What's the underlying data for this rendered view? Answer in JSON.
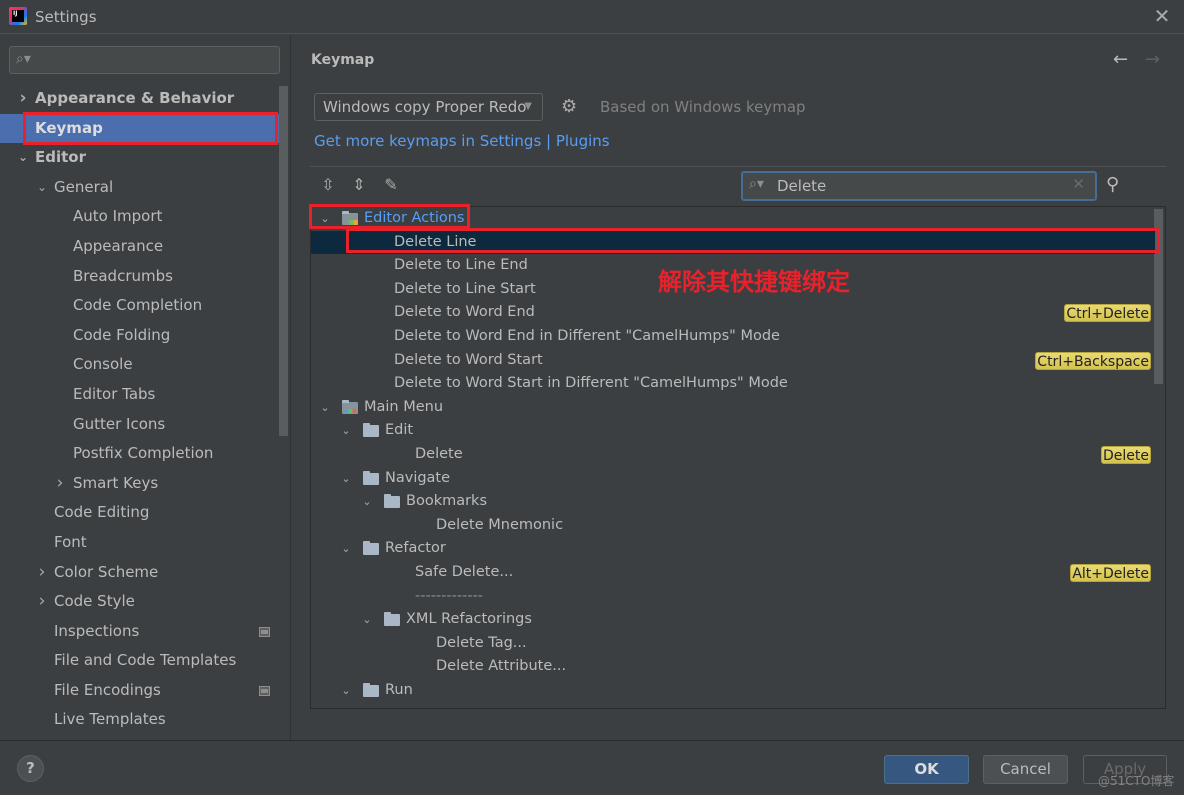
{
  "window": {
    "title": "Settings",
    "close_icon": "close-icon"
  },
  "sidebar": {
    "search": {
      "value": "",
      "placeholder": ""
    },
    "items": [
      {
        "label": "Appearance & Behavior",
        "indent": 0,
        "chevron": "right",
        "bold": true
      },
      {
        "label": "Keymap",
        "indent": 0,
        "chevron": "",
        "bold": true,
        "selected": true
      },
      {
        "label": "Editor",
        "indent": 0,
        "chevron": "down",
        "bold": true
      },
      {
        "label": "General",
        "indent": 1,
        "chevron": "down"
      },
      {
        "label": "Auto Import",
        "indent": 2,
        "chevron": ""
      },
      {
        "label": "Appearance",
        "indent": 2,
        "chevron": ""
      },
      {
        "label": "Breadcrumbs",
        "indent": 2,
        "chevron": ""
      },
      {
        "label": "Code Completion",
        "indent": 2,
        "chevron": ""
      },
      {
        "label": "Code Folding",
        "indent": 2,
        "chevron": ""
      },
      {
        "label": "Console",
        "indent": 2,
        "chevron": ""
      },
      {
        "label": "Editor Tabs",
        "indent": 2,
        "chevron": ""
      },
      {
        "label": "Gutter Icons",
        "indent": 2,
        "chevron": ""
      },
      {
        "label": "Postfix Completion",
        "indent": 2,
        "chevron": ""
      },
      {
        "label": "Smart Keys",
        "indent": 2,
        "chevron": "right"
      },
      {
        "label": "Code Editing",
        "indent": 1,
        "chevron": ""
      },
      {
        "label": "Font",
        "indent": 1,
        "chevron": ""
      },
      {
        "label": "Color Scheme",
        "indent": 1,
        "chevron": "right"
      },
      {
        "label": "Code Style",
        "indent": 1,
        "chevron": "right"
      },
      {
        "label": "Inspections",
        "indent": 1,
        "chevron": "",
        "badge": true
      },
      {
        "label": "File and Code Templates",
        "indent": 1,
        "chevron": ""
      },
      {
        "label": "File Encodings",
        "indent": 1,
        "chevron": "",
        "badge": true
      },
      {
        "label": "Live Templates",
        "indent": 1,
        "chevron": ""
      }
    ]
  },
  "main": {
    "title": "Keymap",
    "keymap_select": "Windows copy Proper Redo",
    "based_on": "Based on Windows keymap",
    "plugins_link": "Get more keymaps in Settings | Plugins",
    "search": {
      "value": "Delete",
      "placeholder": ""
    },
    "annotation": "解除其快捷键绑定",
    "tree": [
      {
        "label": "Editor Actions",
        "level": 0,
        "chevron": "down",
        "icon": "editor",
        "group": true
      },
      {
        "label": "Delete Line",
        "level": 2,
        "selected": true
      },
      {
        "label": "Delete to Line End",
        "level": 2
      },
      {
        "label": "Delete to Line Start",
        "level": 2
      },
      {
        "label": "Delete to Word End",
        "level": 2,
        "shortcut": "Ctrl+Delete"
      },
      {
        "label": "Delete to Word End in Different \"CamelHumps\" Mode",
        "level": 2
      },
      {
        "label": "Delete to Word Start",
        "level": 2,
        "shortcut": "Ctrl+Backspace"
      },
      {
        "label": "Delete to Word Start in Different \"CamelHumps\" Mode",
        "level": 2
      },
      {
        "label": "Main Menu",
        "level": 0,
        "chevron": "down",
        "icon": "menu"
      },
      {
        "label": "Edit",
        "level": 1,
        "chevron": "down",
        "icon": "folder"
      },
      {
        "label": "Delete",
        "level": 3,
        "shortcut": "Delete"
      },
      {
        "label": "Navigate",
        "level": 1,
        "chevron": "down",
        "icon": "folder"
      },
      {
        "label": "Bookmarks",
        "level": 2,
        "chevron": "down",
        "icon": "folder"
      },
      {
        "label": "Delete Mnemonic",
        "level": 4
      },
      {
        "label": "Refactor",
        "level": 1,
        "chevron": "down",
        "icon": "folder"
      },
      {
        "label": "Safe Delete...",
        "level": 3,
        "shortcut": "Alt+Delete"
      },
      {
        "label": "-------------",
        "level": 3,
        "separator": true
      },
      {
        "label": "XML Refactorings",
        "level": 2,
        "chevron": "down",
        "icon": "folder"
      },
      {
        "label": "Delete Tag...",
        "level": 4
      },
      {
        "label": "Delete Attribute...",
        "level": 4
      },
      {
        "label": "Run",
        "level": 1,
        "chevron": "down",
        "icon": "folder"
      }
    ]
  },
  "footer": {
    "help": "?",
    "ok": "OK",
    "cancel": "Cancel",
    "apply": "Apply",
    "watermark": "@51CTO博客"
  }
}
